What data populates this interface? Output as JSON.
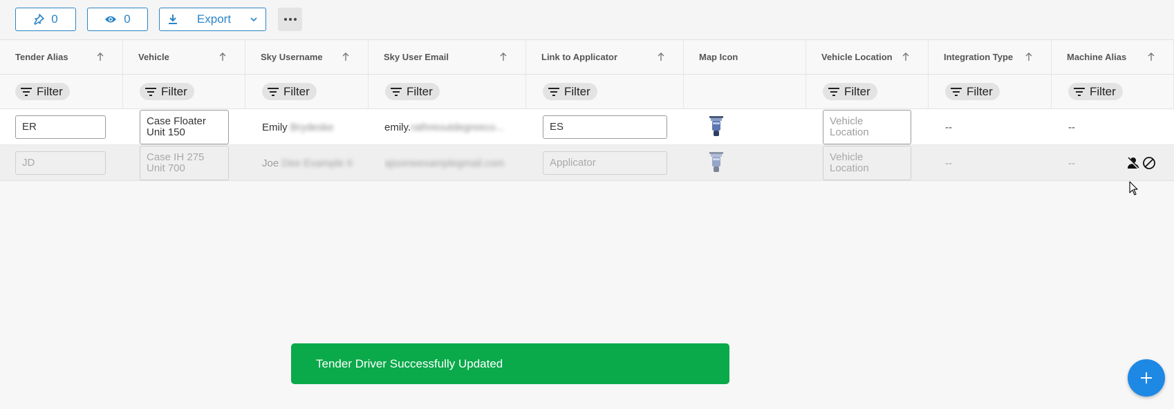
{
  "toolbar": {
    "pinned_count": "0",
    "visible_count": "0",
    "export_label": "Export"
  },
  "columns": [
    {
      "label": "Tender Alias",
      "sortable": true,
      "filter": "Filter"
    },
    {
      "label": "Vehicle",
      "sortable": true,
      "filter": "Filter"
    },
    {
      "label": "Sky Username",
      "sortable": true,
      "filter": "Filter"
    },
    {
      "label": "Sky User Email",
      "sortable": true,
      "filter": "Filter"
    },
    {
      "label": "Link to Applicator",
      "sortable": true,
      "filter": "Filter"
    },
    {
      "label": "Map Icon",
      "sortable": false,
      "filter": ""
    },
    {
      "label": "Vehicle Location",
      "sortable": true,
      "filter": "Filter"
    },
    {
      "label": "Integration Type",
      "sortable": true,
      "filter": "Filter"
    },
    {
      "label": "Machine Alias",
      "sortable": true,
      "filter": "Filter"
    }
  ],
  "rows": [
    {
      "tender_alias": "ER",
      "vehicle_l1": "Case Floater",
      "vehicle_l2": "Unit 150",
      "username_first": "Emily",
      "username_rest": "Brydeske",
      "email_visible": "emily.",
      "email_rest": "rathreoutdegreeco...",
      "applicator": "ES",
      "location_placeholder_l1": "Vehicle",
      "location_placeholder_l2": "Location",
      "integration_type": "--",
      "machine_alias": "--"
    },
    {
      "tender_alias": "JD",
      "vehicle_l1": "Case IH 275",
      "vehicle_l2": "Unit 700",
      "username_first": "Joe",
      "username_rest": "Dee Example II",
      "email_visible": "",
      "email_rest": "ajsomeexamplegmail.com",
      "applicator_placeholder": "Applicator",
      "location_placeholder_l1": "Vehicle",
      "location_placeholder_l2": "Location",
      "integration_type": "--",
      "machine_alias": "--"
    }
  ],
  "toast": {
    "message": "Tender Driver Successfully Updated",
    "color": "#0aa94a"
  },
  "accent_color": "#2a84c6",
  "fab_color": "#1e88e5"
}
